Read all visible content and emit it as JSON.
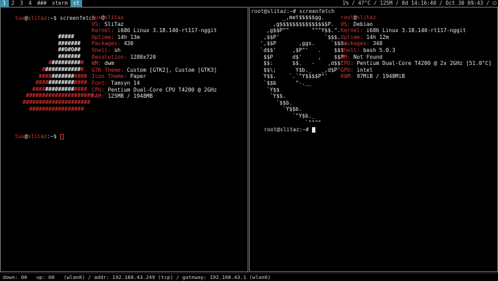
{
  "topbar": {
    "tags": [
      "1",
      "2",
      "3",
      "4",
      "###",
      "xterm",
      "st"
    ],
    "status": "1% / 47°C / 125M / 0d 14:16:40 / Oct 30 09:43 / ⏻"
  },
  "left": {
    "prompt_line": "tux@slitaz:~$ screenfetch",
    "user": "tux",
    "host": "slitaz",
    "logo": [
      "                 #####",
      "                 #######",
      "                 ##O#O##",
      "                 #######",
      "              ###########",
      "            #############",
      "           ###############",
      "          ################",
      "         #################",
      "       #####################",
      "      #####################",
      "        #################"
    ],
    "info": [
      {
        "k": "OS:",
        "v": "SliTaz"
      },
      {
        "k": "Kernel:",
        "v": "i686 Linux 3.18.140-rt117-nggit"
      },
      {
        "k": "Uptime:",
        "v": "14h 13m"
      },
      {
        "k": "Packages:",
        "v": "430"
      },
      {
        "k": "Shell:",
        "v": "sh"
      },
      {
        "k": "Resolution:",
        "v": "1280x720"
      },
      {
        "k": "WM:",
        "v": "dwm"
      },
      {
        "k": "GTK Theme:",
        "v": "Custom [GTK2], Custom [GTK3]"
      },
      {
        "k": "Icon Theme:",
        "v": "Paper"
      },
      {
        "k": "Font:",
        "v": "Tamsyn 14"
      },
      {
        "k": "CPU:",
        "v": "Pentium Dual-Core CPU T4200 @ 2GHz"
      },
      {
        "k": "RAM:",
        "v": "125MB / 1948MB"
      }
    ],
    "prompt2": "tux@slitaz:~$ "
  },
  "right": {
    "prompt_line": "root@slitaz:~# screenfetch",
    "user": "root",
    "host": "slitaz",
    "logo": [
      "         _,met$$$$$gg.",
      "      ,g$$$$$$$$$$$$$$$P.",
      "    ,g$$P\"\"       \"\"\"Y$$.\".",
      "   ,$$P'              `$$$.",
      "  ',$$P       ,ggs.     `$$b:",
      "  `d$$'     ,$P\"'   .    $$$",
      "   $$P      d$'     ,    $$P",
      "   $$:      $$.   -    ,d$$'",
      "   $$\\;      Y$b._   _,d$P'",
      "   Y$$.    `.`\"Y$$$$P\"'",
      "   `$$b      \"-.__",
      "    `Y$$",
      "     `Y$$.",
      "       `$$b.",
      "         `Y$$b.",
      "            `\"Y$b._",
      "                `\"\"\"\""
    ],
    "info": [
      {
        "k": "OS:",
        "v": "Debian"
      },
      {
        "k": "Kernel:",
        "v": "i686 Linux 3.18.140-rt117-nggit"
      },
      {
        "k": "Uptime:",
        "v": "14h 12m"
      },
      {
        "k": "Packages:",
        "v": "348"
      },
      {
        "k": "Shell:",
        "v": "bash 5.0.3"
      },
      {
        "k": "WM:",
        "v": "Not Found"
      },
      {
        "k": "CPU:",
        "v": "Pentium Dual-Core T4200 @ 2x 2GHz [51.0°C]"
      },
      {
        "k": "GPU:",
        "v": "intel"
      },
      {
        "k": "RAM:",
        "v": "97MiB / 1948MiB"
      }
    ],
    "prompt2": "root@slitaz:~# "
  },
  "bottombar": {
    "text": "down: 00   up: 00   (wlan0) / addr: 192.168.43.249 (tcp) / gateway: 192.168.43.1 (wlan0)"
  },
  "colors": {
    "accent": "#3b8fa7",
    "key": "#d93a3a",
    "logo_red": "#d02a2a"
  }
}
